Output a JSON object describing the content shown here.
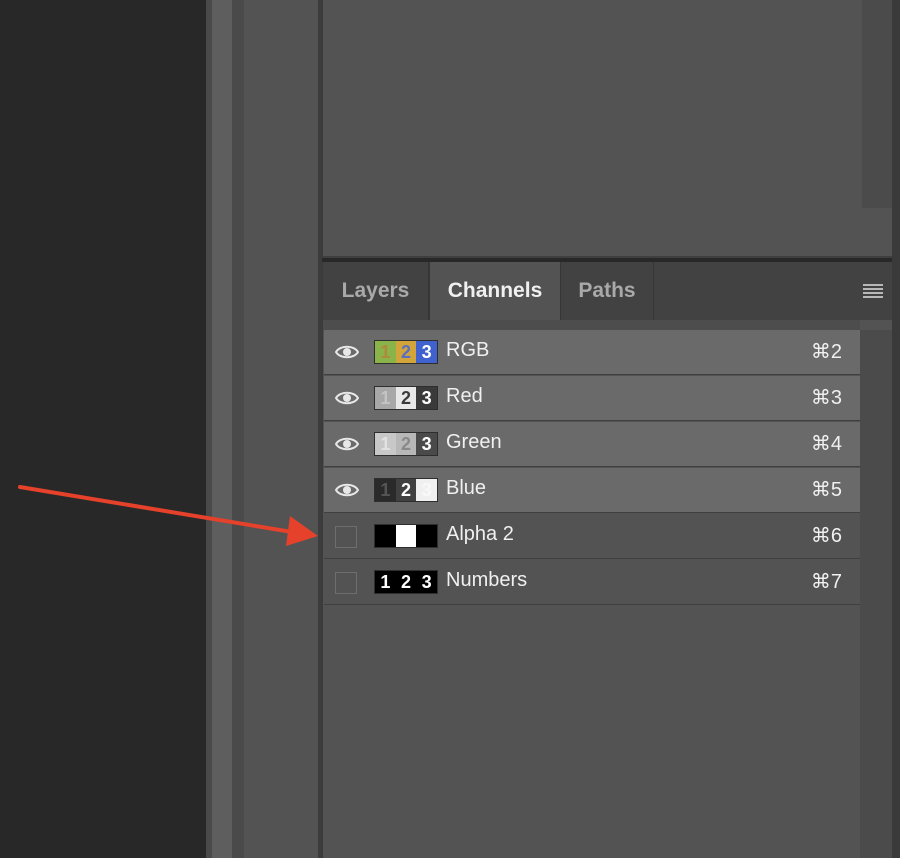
{
  "tabs": [
    {
      "label": "Layers",
      "active": false
    },
    {
      "label": "Channels",
      "active": true
    },
    {
      "label": "Paths",
      "active": false
    }
  ],
  "channels": [
    {
      "name": "RGB",
      "shortcut": "⌘2",
      "visible": true,
      "selected": true,
      "thumb": [
        {
          "digit": "1",
          "bg": "#8ab34a",
          "fg": "#b0893c"
        },
        {
          "digit": "2",
          "bg": "#d2a53b",
          "fg": "#5b6fc2"
        },
        {
          "digit": "3",
          "bg": "#3f62cf",
          "fg": "#ffffff"
        }
      ]
    },
    {
      "name": "Red",
      "shortcut": "⌘3",
      "visible": true,
      "selected": true,
      "thumb": [
        {
          "digit": "1",
          "bg": "#a8a8a8",
          "fg": "#c4c4c4"
        },
        {
          "digit": "2",
          "bg": "#e8e8e8",
          "fg": "#3a3a3a"
        },
        {
          "digit": "3",
          "bg": "#3a3a3a",
          "fg": "#ffffff"
        }
      ]
    },
    {
      "name": "Green",
      "shortcut": "⌘4",
      "visible": true,
      "selected": true,
      "thumb": [
        {
          "digit": "1",
          "bg": "#c8c8c8",
          "fg": "#e2e2e2"
        },
        {
          "digit": "2",
          "bg": "#b8b8b8",
          "fg": "#8a8a8a"
        },
        {
          "digit": "3",
          "bg": "#4a4a4a",
          "fg": "#ffffff"
        }
      ]
    },
    {
      "name": "Blue",
      "shortcut": "⌘5",
      "visible": true,
      "selected": true,
      "thumb": [
        {
          "digit": "1",
          "bg": "#2a2a2a",
          "fg": "#555555"
        },
        {
          "digit": "2",
          "bg": "#404040",
          "fg": "#ffffff"
        },
        {
          "digit": "3",
          "bg": "#f0f0f0",
          "fg": "#f8f8f8"
        }
      ]
    },
    {
      "name": "Alpha 2",
      "shortcut": "⌘6",
      "visible": false,
      "selected": false,
      "thumb": [
        {
          "digit": "",
          "bg": "#000000",
          "fg": "#000000"
        },
        {
          "digit": "",
          "bg": "#ffffff",
          "fg": "#ffffff"
        },
        {
          "digit": "",
          "bg": "#000000",
          "fg": "#000000"
        }
      ]
    },
    {
      "name": "Numbers",
      "shortcut": "⌘7",
      "visible": false,
      "selected": false,
      "thumb": [
        {
          "digit": "1",
          "bg": "#000000",
          "fg": "#ffffff"
        },
        {
          "digit": "2",
          "bg": "#000000",
          "fg": "#ffffff"
        },
        {
          "digit": "3",
          "bg": "#000000",
          "fg": "#ffffff"
        }
      ]
    }
  ],
  "icons": {
    "visibility": "eye-icon",
    "panel_menu": "hamburger-menu-icon",
    "annotation": "red-arrow"
  },
  "colors": {
    "annotation_arrow": "#e5412b",
    "selected_row": "#6a6a6a",
    "panel_bg": "#535353"
  }
}
